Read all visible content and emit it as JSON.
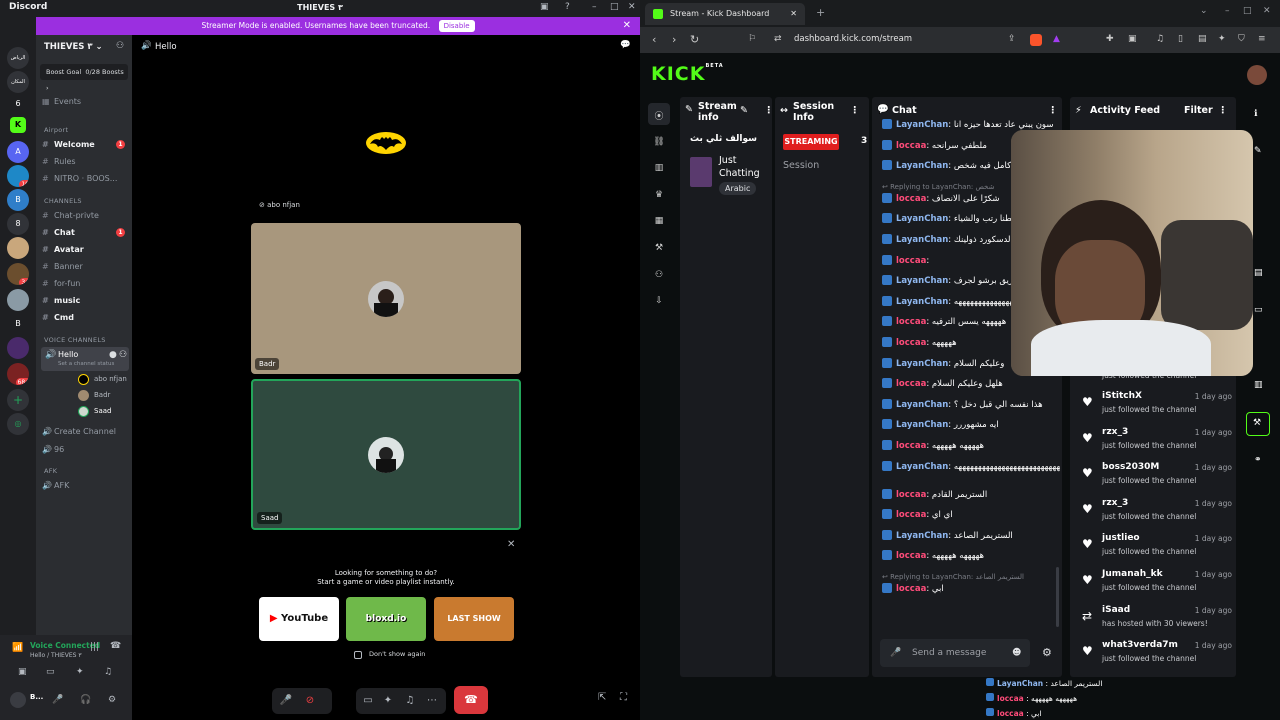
{
  "discord": {
    "window_title": "THIEVES ٣",
    "streamer_banner": {
      "text": "Streamer Mode is enabled. Usernames have been truncated.",
      "button": "Disable"
    },
    "guild_name": "THIEVES ٣",
    "boost": {
      "label": "Boost Goal",
      "count": "0/28 Boosts"
    },
    "events": "Events",
    "categories": {
      "airport": "Airport",
      "channels": "CHANNELS",
      "voice": "VOICE CHANNELS",
      "afk": "AFK"
    },
    "airport_channels": [
      {
        "name": "Welcome",
        "bold": true,
        "badge": "1"
      },
      {
        "name": "Rules",
        "bold": false,
        "badge": ""
      },
      {
        "name": "NITRO · BOOS...",
        "bold": false,
        "badge": ""
      }
    ],
    "text_channels": [
      {
        "name": "Chat-privte",
        "bold": false,
        "badge": ""
      },
      {
        "name": "Chat",
        "bold": true,
        "badge": "1"
      },
      {
        "name": "Avatar",
        "bold": true,
        "badge": ""
      },
      {
        "name": "Banner",
        "bold": false,
        "badge": ""
      },
      {
        "name": "for-fun",
        "bold": false,
        "badge": ""
      },
      {
        "name": "music",
        "bold": true,
        "badge": ""
      },
      {
        "name": "Cmd",
        "bold": true,
        "badge": ""
      }
    ],
    "voice_channel": {
      "name": "Hello",
      "status": "Set a channel status"
    },
    "voice_members": [
      "abo nfjan",
      "Badr",
      "Saad"
    ],
    "create_channel": "Create Channel",
    "other_voice": "96",
    "afk_channel": "AFK",
    "voice_connected": {
      "title": "Voice Connected",
      "sub": "Hello / THIEVES ٣"
    },
    "user_name": "B...",
    "server_rail": [
      "الرياض",
      "المكان",
      "6",
      "K",
      "A",
      "16",
      "B",
      "8",
      "34",
      "",
      "B",
      "",
      "684",
      "+",
      ""
    ],
    "main": {
      "channel_title": "Hello",
      "tiles": [
        {
          "name": "abo nfjan",
          "bg": "#000000"
        },
        {
          "name": "Badr",
          "bg": "#a8977d"
        },
        {
          "name": "Saad",
          "bg": "#2f4a3f"
        }
      ],
      "activity": {
        "title": "Looking for something to do?",
        "sub": "Start a game or video playlist instantly.",
        "items": [
          "YouTube",
          "bloxd.io",
          "LAST SHOW"
        ],
        "checkbox": "Don't show again"
      }
    }
  },
  "browser": {
    "tab_title": "Stream - Kick Dashboard",
    "url": "dashboard.kick.com/stream",
    "logo": "KICK",
    "logo_sup": "BETA"
  },
  "kick": {
    "panels": {
      "stream_info": {
        "title": "Stream info",
        "stream_title": "سوالف ثلي بث",
        "category": "Just Chatting",
        "tag": "Arabic"
      },
      "session_info": {
        "title": "Session Info",
        "status": "STREAMING",
        "count": "3",
        "session": "Session"
      },
      "chat": {
        "title": "Chat",
        "placeholder": "Send a message"
      },
      "activity": {
        "title": "Activity Feed",
        "filter": "Filter"
      }
    },
    "chat_messages": [
      {
        "user": "LayanChan",
        "text": "سون يبني عاد تعدها حيزه انا"
      },
      {
        "user": "loccaa",
        "text": "ملطفي سرانحه"
      },
      {
        "user": "LayanChan",
        "text": "ثمب 500 برفر كامل فيه شخص"
      },
      {
        "reply": "Replying to LayanChan: شخص"
      },
      {
        "user": "loccaa",
        "text": "شكرًا على الانصاف"
      },
      {
        "user": "LayanChan",
        "text": "وعطنا رتب والشياء"
      },
      {
        "user": "LayanChan",
        "text": "من ادمنية الدسكورد ذولينك"
      },
      {
        "user": "loccaa",
        "text": ""
      },
      {
        "user": "LayanChan",
        "text": "وبريق برشو لجرف"
      },
      {
        "user": "LayanChan",
        "text": "هههههههههههههههه"
      },
      {
        "user": "loccaa",
        "text": "هههههه يسس الترفيه"
      },
      {
        "user": "loccaa",
        "text": "هههههه"
      },
      {
        "user": "LayanChan",
        "text": "وعليكم السلام"
      },
      {
        "user": "loccaa",
        "text": "هلهل وعليكم السلام"
      },
      {
        "user": "LayanChan",
        "text": "هذا نفسه الي قبل دخل ؟"
      },
      {
        "user": "LayanChan",
        "text": "ايه مشهوررر"
      },
      {
        "user": "loccaa",
        "text": "هههههه هههههه"
      },
      {
        "user": "LayanChan",
        "text": "هههههههههههههههههههههههههههههههههههههه"
      },
      {
        "user": "loccaa",
        "text": "الستريمر القادم"
      },
      {
        "user": "loccaa",
        "text": "اي اي"
      },
      {
        "user": "LayanChan",
        "text": "الستريمر الصاعد"
      },
      {
        "user": "loccaa",
        "text": "هههههه هههههه"
      },
      {
        "reply": "Replying to LayanChan: الستريمر الصاعد"
      },
      {
        "user": "loccaa",
        "text": "ابي"
      }
    ],
    "activity_feed": [
      {
        "name": "iStitchX",
        "time": "1 day ago",
        "desc": "just followed the channel"
      },
      {
        "name": "rzx_3",
        "time": "1 day ago",
        "desc": "just followed the channel"
      },
      {
        "name": "boss2030M",
        "time": "1 day ago",
        "desc": "just followed the channel"
      },
      {
        "name": "rzx_3",
        "time": "1 day ago",
        "desc": "just followed the channel"
      },
      {
        "name": "justlieo",
        "time": "1 day ago",
        "desc": "just followed the channel"
      },
      {
        "name": "Jumanah_kk",
        "time": "1 day ago",
        "desc": "just followed the channel"
      },
      {
        "name": "iSaad",
        "time": "1 day ago",
        "desc": "has hosted with 30 viewers!"
      },
      {
        "name": "what3verda7m",
        "time": "1 day ago",
        "desc": "just followed the channel"
      }
    ],
    "activity_partial": "just followed the channel",
    "ticker": [
      {
        "user": "LayanChan",
        "text": "الستريمر الصاعد"
      },
      {
        "user": "loccaa",
        "text": "هههههه هههههه"
      },
      {
        "user": "loccaa",
        "text": "ابي"
      }
    ]
  },
  "colors": {
    "kick_green": "#53fc18",
    "discord_purple": "#9b2fe0",
    "discord_red": "#f23f42",
    "leave_red": "#da373c"
  }
}
